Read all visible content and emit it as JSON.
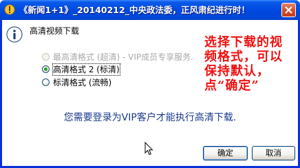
{
  "window": {
    "title": "《新闻1+1》_20140212_中央政法委，正风肃纪进行时！"
  },
  "dialog": {
    "heading": "高清视频下载",
    "options": [
      {
        "label": "最高清格式 (超清) - VIP成员专享服务.",
        "state": "disabled",
        "selected": false
      },
      {
        "label": "高清格式 2 (标清)",
        "state": "enabled",
        "selected": true
      },
      {
        "label": "标清格式 (流畅)",
        "state": "enabled",
        "selected": false
      }
    ],
    "annotation": "选择下载的视频格式，可以保持默认，点“确定”",
    "login_message": "您需要登录为VIP客户才能执行高清下载.",
    "ok_label": "确定",
    "cancel_label": "取消"
  },
  "colors": {
    "titlebar_blue": "#0049e0",
    "annotation_red": "#ee1111",
    "message_blue": "#1a3a8a",
    "radio_selected_green": "#21a121"
  },
  "icons": {
    "title": "app-icon",
    "close": "close-icon",
    "info": "info-icon",
    "cursor": "mouse-cursor-icon"
  }
}
